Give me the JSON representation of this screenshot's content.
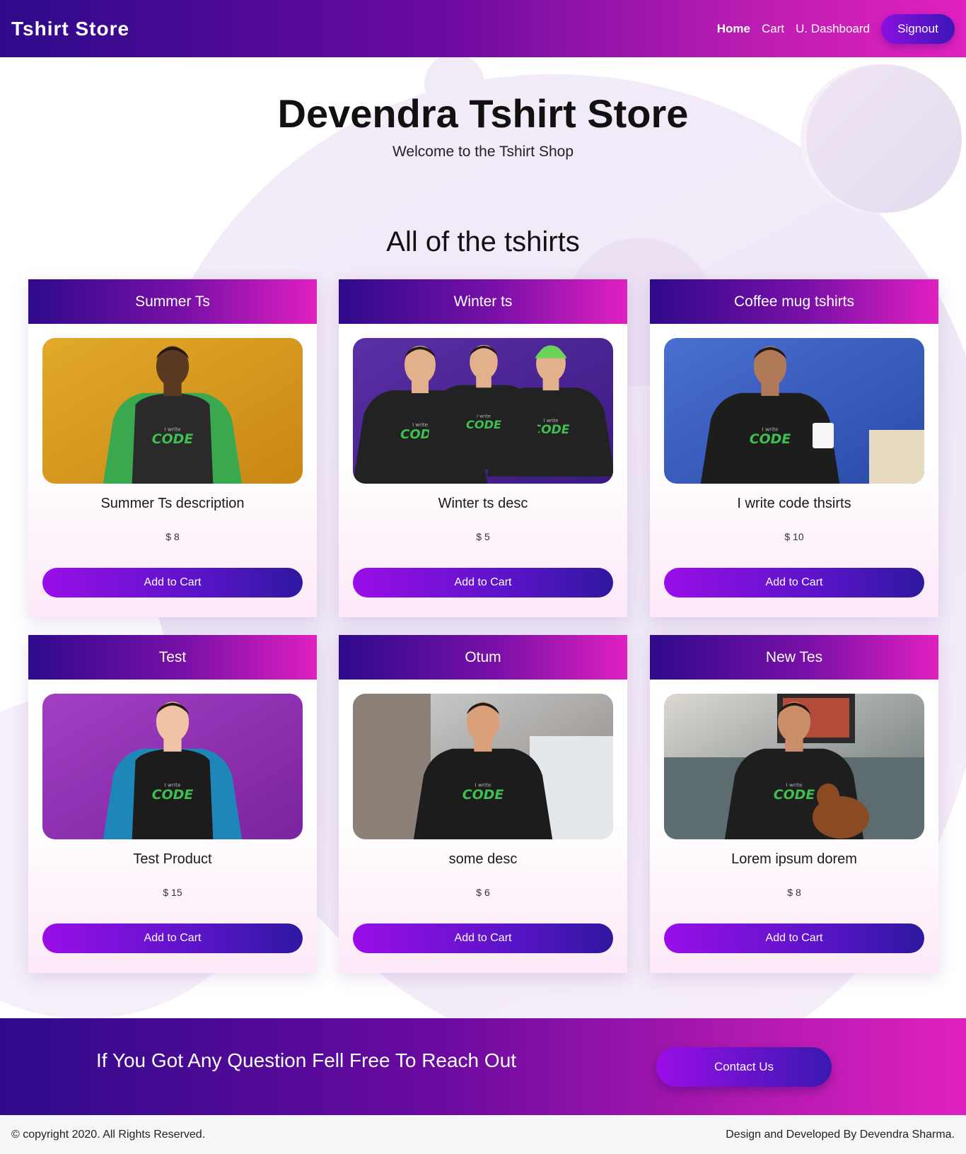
{
  "navbar": {
    "brand": "Tshirt Store",
    "links": [
      "Home",
      "Cart",
      "U. Dashboard"
    ],
    "signout": "Signout"
  },
  "hero": {
    "title": "Devendra Tshirt Store",
    "subtitle": "Welcome to the Tshirt Shop"
  },
  "products_section": {
    "title": "All of the tshirts",
    "button_label": "Add to Cart",
    "items": [
      {
        "name": "Summer Ts",
        "description": "Summer Ts description",
        "price": "$ 8",
        "image_icon": "tshirt-photo-man-yellow-bg"
      },
      {
        "name": "Winter ts",
        "description": "Winter ts desc",
        "price": "$ 5",
        "image_icon": "hoodie-photo-group-purple-bg"
      },
      {
        "name": "Coffee mug tshirts",
        "description": "I write code thsirts",
        "price": "$ 10",
        "image_icon": "tshirt-photo-man-mug-blue-bg"
      },
      {
        "name": "Test",
        "description": "Test Product",
        "price": "$ 15",
        "image_icon": "tshirt-photo-woman-purple-bg"
      },
      {
        "name": "Otum",
        "description": "some desc",
        "price": "$ 6",
        "image_icon": "tshirt-photo-man-street"
      },
      {
        "name": "New Tes",
        "description": "Lorem ipsum dorem",
        "price": "$ 8",
        "image_icon": "tshirt-photo-man-dog-sofa"
      }
    ],
    "print_text": {
      "small": "I write",
      "big": "CODE"
    }
  },
  "contact": {
    "text": "If You Got Any Question Fell Free To Reach Out",
    "button": "Contact Us"
  },
  "footer": {
    "left": "© copyright 2020. All Rights Reserved.",
    "right": "Design and Developed By Devendra Sharma."
  },
  "colors": {
    "gradient_start": "#2e0a8a",
    "gradient_end": "#e020c0",
    "button_start": "#9a0ee8",
    "button_end": "#2e18a0"
  }
}
